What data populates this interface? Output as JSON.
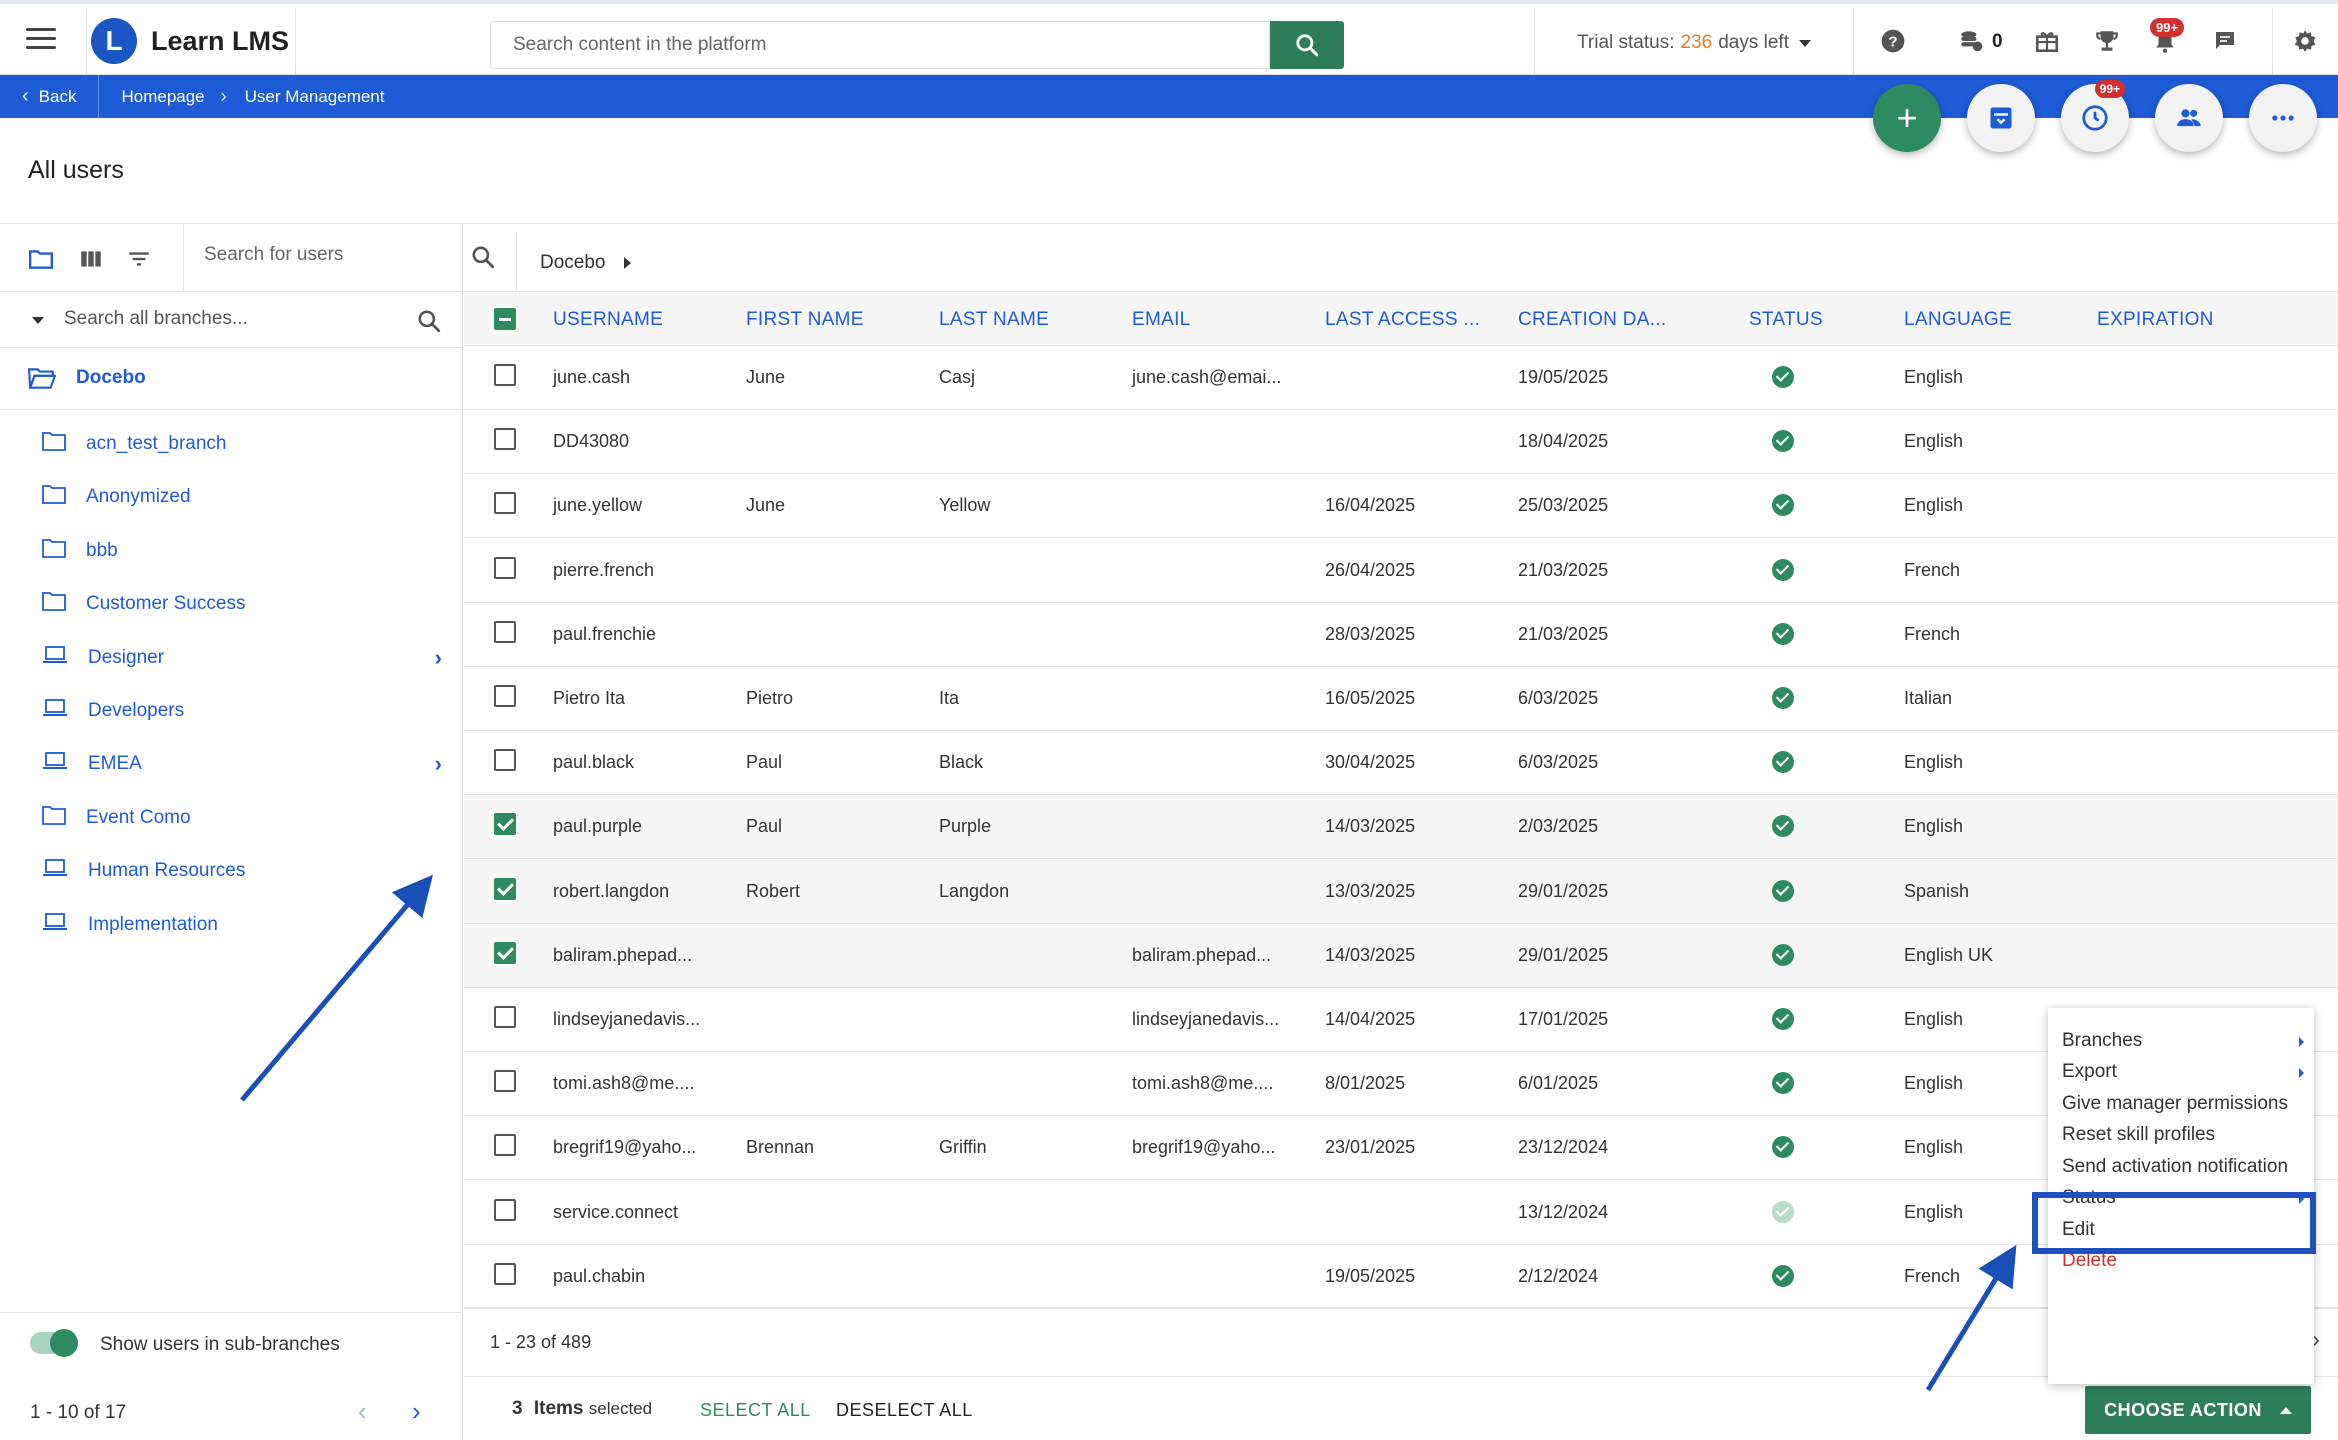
{
  "app": {
    "name": "Learn LMS",
    "logo_letter": "L"
  },
  "header": {
    "search_placeholder": "Search content in the platform",
    "trial_label": "Trial status:",
    "trial_days": "236",
    "trial_suffix": "days left",
    "coins": "0",
    "notifications_badge": "99+"
  },
  "breadcrumb": {
    "back": "Back",
    "items": [
      "Homepage",
      "User Management"
    ]
  },
  "fab": {
    "history_badge": "99+"
  },
  "page": {
    "title": "All users"
  },
  "left_panel": {
    "user_search_placeholder": "Search for users",
    "branch_search_placeholder": "Search all branches...",
    "root_branch": "Docebo",
    "branches": [
      {
        "label": "acn_test_branch",
        "icon": "folder-icon",
        "has_children": false
      },
      {
        "label": "Anonymized",
        "icon": "folder-icon",
        "has_children": false
      },
      {
        "label": "bbb",
        "icon": "folder-icon",
        "has_children": false
      },
      {
        "label": "Customer Success",
        "icon": "folder-icon",
        "has_children": false
      },
      {
        "label": "Designer",
        "icon": "laptop-icon",
        "has_children": true
      },
      {
        "label": "Developers",
        "icon": "laptop-icon",
        "has_children": false
      },
      {
        "label": "EMEA",
        "icon": "laptop-icon",
        "has_children": true
      },
      {
        "label": "Event Como",
        "icon": "folder-icon",
        "has_children": false
      },
      {
        "label": "Human Resources",
        "icon": "laptop-icon",
        "has_children": false
      },
      {
        "label": "Implementation",
        "icon": "laptop-icon",
        "has_children": false
      }
    ],
    "toggle_label": "Show users in sub-branches",
    "pager": "1 - 10 of 17"
  },
  "right_panel": {
    "breadcrumb": "Docebo",
    "columns": [
      "USERNAME",
      "FIRST NAME",
      "LAST NAME",
      "EMAIL",
      "LAST ACCESS ...",
      "CREATION DA...",
      "STATUS",
      "LANGUAGE",
      "EXPIRATION"
    ],
    "rows": [
      {
        "username": "june.cash",
        "first": "June",
        "last": "Casj",
        "email": "june.cash@emai...",
        "last_access": "",
        "created": "19/05/2025",
        "status": "active",
        "language": "English",
        "checked": false
      },
      {
        "username": "DD43080",
        "first": "",
        "last": "",
        "email": "",
        "last_access": "",
        "created": "18/04/2025",
        "status": "active",
        "language": "English",
        "checked": false
      },
      {
        "username": "june.yellow",
        "first": "June",
        "last": "Yellow",
        "email": "",
        "last_access": "16/04/2025",
        "created": "25/03/2025",
        "status": "active",
        "language": "English",
        "checked": false
      },
      {
        "username": "pierre.french",
        "first": "",
        "last": "",
        "email": "",
        "last_access": "26/04/2025",
        "created": "21/03/2025",
        "status": "active",
        "language": "French",
        "checked": false
      },
      {
        "username": "paul.frenchie",
        "first": "",
        "last": "",
        "email": "",
        "last_access": "28/03/2025",
        "created": "21/03/2025",
        "status": "active",
        "language": "French",
        "checked": false
      },
      {
        "username": "Pietro Ita",
        "first": "Pietro",
        "last": "Ita",
        "email": "",
        "last_access": "16/05/2025",
        "created": "6/03/2025",
        "status": "active",
        "language": "Italian",
        "checked": false
      },
      {
        "username": "paul.black",
        "first": "Paul",
        "last": "Black",
        "email": "",
        "last_access": "30/04/2025",
        "created": "6/03/2025",
        "status": "active",
        "language": "English",
        "checked": false
      },
      {
        "username": "paul.purple",
        "first": "Paul",
        "last": "Purple",
        "email": "",
        "last_access": "14/03/2025",
        "created": "2/03/2025",
        "status": "active",
        "language": "English",
        "checked": true
      },
      {
        "username": "robert.langdon",
        "first": "Robert",
        "last": "Langdon",
        "email": "",
        "last_access": "13/03/2025",
        "created": "29/01/2025",
        "status": "active",
        "language": "Spanish",
        "checked": true
      },
      {
        "username": "baliram.phepad...",
        "first": "",
        "last": "",
        "email": "baliram.phepad...",
        "last_access": "14/03/2025",
        "created": "29/01/2025",
        "status": "active",
        "language": "English UK",
        "checked": true
      },
      {
        "username": "lindseyjanedavis...",
        "first": "",
        "last": "",
        "email": "lindseyjanedavis...",
        "last_access": "14/04/2025",
        "created": "17/01/2025",
        "status": "active",
        "language": "English",
        "checked": false
      },
      {
        "username": "tomi.ash8@me....",
        "first": "",
        "last": "",
        "email": "tomi.ash8@me....",
        "last_access": "8/01/2025",
        "created": "6/01/2025",
        "status": "active",
        "language": "English",
        "checked": false
      },
      {
        "username": "bregrif19@yaho...",
        "first": "Brennan",
        "last": "Griffin",
        "email": "bregrif19@yaho...",
        "last_access": "23/01/2025",
        "created": "23/12/2024",
        "status": "active",
        "language": "English",
        "checked": false
      },
      {
        "username": "service.connect",
        "first": "",
        "last": "",
        "email": "",
        "last_access": "",
        "created": "13/12/2024",
        "status": "inactive",
        "language": "English",
        "checked": false
      },
      {
        "username": "paul.chabin",
        "first": "",
        "last": "",
        "email": "",
        "last_access": "19/05/2025",
        "created": "2/12/2024",
        "status": "active",
        "language": "French",
        "checked": false
      }
    ],
    "pager": "1 - 23 of 489"
  },
  "selection": {
    "count": "3",
    "items_word": "Items",
    "selected_word": "selected",
    "select_all": "SELECT ALL",
    "deselect_all": "DESELECT ALL",
    "choose_action": "CHOOSE ACTION"
  },
  "action_menu": {
    "items": [
      {
        "label": "Branches",
        "submenu": true
      },
      {
        "label": "Export",
        "submenu": true
      },
      {
        "label": "Give manager permissions",
        "submenu": false
      },
      {
        "label": "Reset skill profiles",
        "submenu": false
      },
      {
        "label": "Send activation notification",
        "submenu": false,
        "highlighted": true
      },
      {
        "label": "Status",
        "submenu": true
      },
      {
        "label": "Edit",
        "submenu": false
      },
      {
        "label": "Delete",
        "submenu": false,
        "danger": true
      }
    ]
  },
  "colors": {
    "brand_blue": "#1e5bd7",
    "green": "#2e7d5b",
    "trial_orange": "#e07b2c",
    "danger": "#d32f2f"
  }
}
